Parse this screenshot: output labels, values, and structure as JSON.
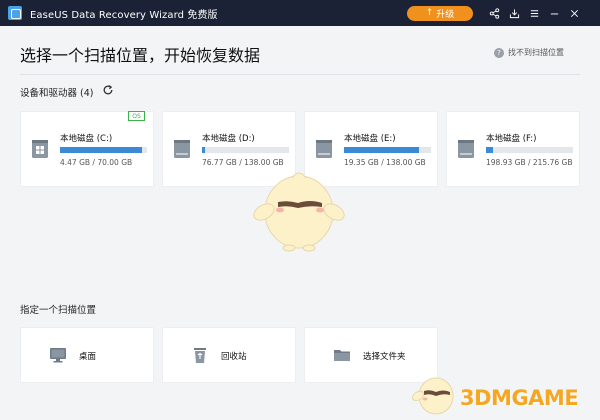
{
  "titlebar": {
    "app_title": "EaseUS Data Recovery Wizard 免费版",
    "upgrade_label": "升级",
    "icons": [
      "share-icon",
      "import-icon",
      "menu-icon",
      "minimize-icon",
      "close-icon"
    ]
  },
  "header": {
    "title": "选择一个扫描位置，开始恢复数据",
    "help_link": "找不到扫描位置"
  },
  "devices": {
    "section_label": "设备和驱动器 (4)",
    "drives": [
      {
        "name": "本地磁盘 (C:)",
        "size": "4.47 GB / 70.00 GB",
        "used_fraction": 0.94,
        "badge": "OS",
        "icon": "windows-drive-icon"
      },
      {
        "name": "本地磁盘 (D:)",
        "size": "76.77 GB / 138.00 GB",
        "used_fraction": 0.04,
        "icon": "hard-drive-icon"
      },
      {
        "name": "本地磁盘 (E:)",
        "size": "19.35 GB / 138.00 GB",
        "used_fraction": 0.86,
        "icon": "hard-drive-icon"
      },
      {
        "name": "本地磁盘 (F:)",
        "size": "198.93 GB / 215.76 GB",
        "used_fraction": 0.08,
        "icon": "hard-drive-icon"
      }
    ]
  },
  "locations": {
    "section_label": "指定一个扫描位置",
    "items": [
      {
        "label": "桌面",
        "icon": "desktop-icon"
      },
      {
        "label": "回收站",
        "icon": "recycle-bin-icon"
      },
      {
        "label": "选择文件夹",
        "icon": "folder-icon"
      }
    ]
  },
  "watermark": {
    "text": "3DMGAME"
  },
  "colors": {
    "titlebar": "#1b2236",
    "accent": "#f0911e",
    "bar": "#3b8ad8",
    "badge": "#39b54a"
  }
}
